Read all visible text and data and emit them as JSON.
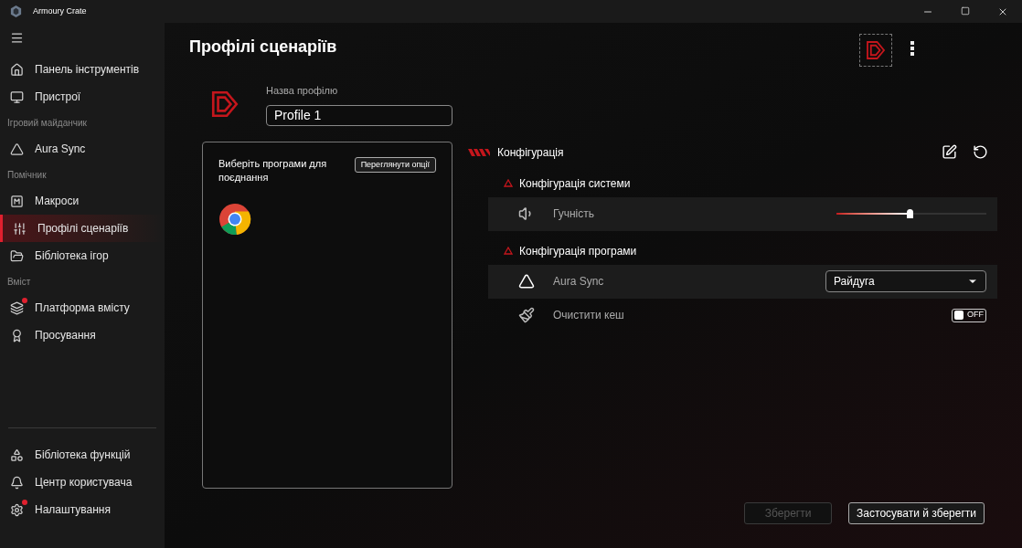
{
  "window": {
    "title": "Armoury Crate"
  },
  "sidebar": {
    "items": [
      {
        "kind": "item",
        "label": "Панель інструментів",
        "selected": false,
        "badge": false
      },
      {
        "kind": "item",
        "label": "Пристрої",
        "selected": false,
        "badge": false
      },
      {
        "kind": "header",
        "label": "Ігровий майданчик"
      },
      {
        "kind": "item",
        "label": "Aura Sync",
        "selected": false,
        "badge": false
      },
      {
        "kind": "header",
        "label": "Помічник"
      },
      {
        "kind": "item",
        "label": "Макроси",
        "selected": false,
        "badge": false
      },
      {
        "kind": "item",
        "label": "Профілі сценаріїв",
        "selected": true,
        "badge": false
      },
      {
        "kind": "item",
        "label": "Бібліотека ігор",
        "selected": false,
        "badge": false
      },
      {
        "kind": "header",
        "label": "Вміст"
      },
      {
        "kind": "item",
        "label": "Платформа вмісту",
        "selected": false,
        "badge": true
      },
      {
        "kind": "item",
        "label": "Просування",
        "selected": false,
        "badge": false
      }
    ],
    "bottom_items": [
      {
        "label": "Бібліотека функцій",
        "selected": false,
        "badge": false
      },
      {
        "label": "Центр користувача",
        "selected": false,
        "badge": false
      },
      {
        "label": "Налаштування",
        "selected": false,
        "badge": true
      }
    ]
  },
  "page": {
    "title": "Профілі сценаріїв",
    "profile_name": {
      "label": "Назва профілю",
      "value": "Profile 1"
    },
    "apps_panel": {
      "text": "Виберіть програми для поєднання",
      "button": "Переглянути опції"
    },
    "config": {
      "title": "Конфігурація",
      "sections": [
        {
          "title": "Конфігурація системи",
          "rows": [
            {
              "kind": "slider",
              "label": "Гучність",
              "level": 0.49
            }
          ]
        },
        {
          "title": "Конфігурація програми",
          "rows": [
            {
              "kind": "dropdown",
              "label": "Aura Sync",
              "value": "Райдуга"
            },
            {
              "kind": "toggle",
              "label": "Очистити кеш",
              "on": false,
              "text": "OFF"
            }
          ]
        }
      ]
    },
    "buttons": [
      {
        "label": "Зберегти",
        "disabled": true
      },
      {
        "label": "Застосувати й зберегти",
        "disabled": false
      }
    ]
  }
}
